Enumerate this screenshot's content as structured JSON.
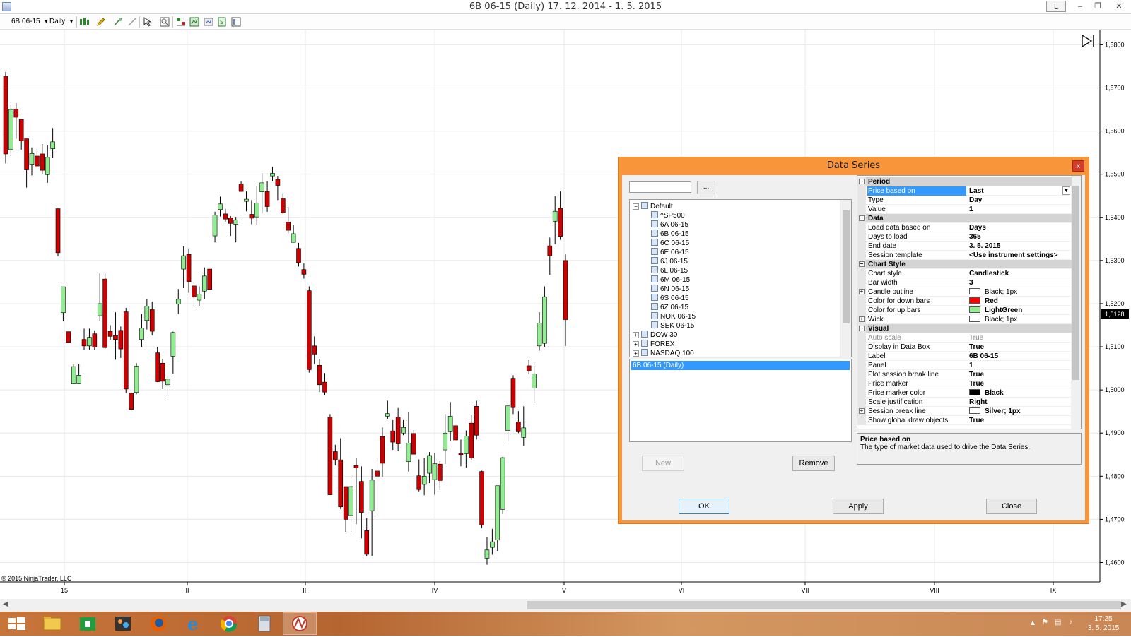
{
  "window": {
    "title": "6B 06-15 (Daily)  17. 12. 2014 - 1. 5. 2015",
    "link_button": "L",
    "minimize": "–",
    "restore": "❐",
    "close": "✕"
  },
  "toolbar": {
    "instrument": "6B 06-15",
    "period": "Daily",
    "dropdown_glyph": "▾"
  },
  "chart": {
    "copyright": "© 2015 NinjaTrader, LLC",
    "current_price": "1,5128",
    "price_labels": [
      "1,5800",
      "1,5700",
      "1,5600",
      "1,5500",
      "1,5400",
      "1,5300",
      "1,5200",
      "1,5100",
      "1,5000",
      "1,4900",
      "1,4800",
      "1,4700",
      "1,4600"
    ],
    "time_labels": [
      "15",
      "II",
      "III",
      "IV",
      "V",
      "VI",
      "VII",
      "VIII",
      "IX"
    ],
    "up_color": "#90EE90",
    "down_color": "#CC0000",
    "wick_color": "#000000"
  },
  "chart_data": {
    "type": "candlestick",
    "title": "6B 06-15 (Daily)",
    "ylim": [
      1.4555,
      1.5835
    ],
    "y_ticks": [
      1.58,
      1.57,
      1.56,
      1.55,
      1.54,
      1.53,
      1.52,
      1.51,
      1.5,
      1.49,
      1.48,
      1.47,
      1.46
    ],
    "x_ticks": [
      "15",
      "II",
      "III",
      "IV",
      "V",
      "VI",
      "VII",
      "VIII",
      "IX"
    ],
    "last_price": 1.5128,
    "candles": [
      {
        "o": 1.5727,
        "h": 1.5737,
        "l": 1.5525,
        "c": 1.5547
      },
      {
        "o": 1.5557,
        "h": 1.5661,
        "l": 1.5542,
        "c": 1.565
      },
      {
        "o": 1.5651,
        "h": 1.5665,
        "l": 1.5582,
        "c": 1.5632
      },
      {
        "o": 1.5627,
        "h": 1.56,
        "l": 1.5557,
        "c": 1.5577
      },
      {
        "o": 1.5582,
        "h": 1.5562,
        "l": 1.5469,
        "c": 1.551
      },
      {
        "o": 1.5523,
        "h": 1.5562,
        "l": 1.5497,
        "c": 1.5548
      },
      {
        "o": 1.5542,
        "h": 1.5562,
        "l": 1.5515,
        "c": 1.5519
      },
      {
        "o": 1.5547,
        "h": 1.557,
        "l": 1.55,
        "c": 1.5509
      },
      {
        "o": 1.5499,
        "h": 1.5567,
        "l": 1.548,
        "c": 1.5539
      },
      {
        "o": 1.5559,
        "h": 1.5607,
        "l": 1.5537,
        "c": 1.5575
      },
      {
        "o": 1.542,
        "h": 1.542,
        "l": 1.531,
        "c": 1.5318
      },
      {
        "o": 1.5179,
        "h": 1.5239,
        "l": 1.5159,
        "c": 1.5239
      },
      {
        "o": 1.5135,
        "h": 1.5135,
        "l": 1.511,
        "c": 1.511
      },
      {
        "o": 1.5014,
        "h": 1.506,
        "l": 1.5031,
        "c": 1.5054
      },
      {
        "o": 1.5014,
        "h": 1.506,
        "l": 1.5034,
        "c": 1.5034
      },
      {
        "o": 1.5117,
        "h": 1.5142,
        "l": 1.5092,
        "c": 1.5102
      },
      {
        "o": 1.5102,
        "h": 1.5142,
        "l": 1.5092,
        "c": 1.5122
      },
      {
        "o": 1.513,
        "h": 1.5138,
        "l": 1.5092,
        "c": 1.5099
      },
      {
        "o": 1.5172,
        "h": 1.527,
        "l": 1.5159,
        "c": 1.52
      },
      {
        "o": 1.5257,
        "h": 1.527,
        "l": 1.5095,
        "c": 1.5098
      },
      {
        "o": 1.5136,
        "h": 1.515,
        "l": 1.5116,
        "c": 1.5124
      },
      {
        "o": 1.5126,
        "h": 1.518,
        "l": 1.507,
        "c": 1.5117
      },
      {
        "o": 1.5138,
        "h": 1.5147,
        "l": 1.5074,
        "c": 1.5095
      },
      {
        "o": 1.5181,
        "h": 1.519,
        "l": 1.4993,
        "c": 1.5002
      },
      {
        "o": 1.4993,
        "h": 1.4974,
        "l": 1.4955,
        "c": 1.4955
      },
      {
        "o": 1.4994,
        "h": 1.5062,
        "l": 1.499,
        "c": 1.5055
      },
      {
        "o": 1.5117,
        "h": 1.5176,
        "l": 1.51,
        "c": 1.5143
      },
      {
        "o": 1.5161,
        "h": 1.521,
        "l": 1.514,
        "c": 1.5194
      },
      {
        "o": 1.5186,
        "h": 1.5205,
        "l": 1.5126,
        "c": 1.5136
      },
      {
        "o": 1.5086,
        "h": 1.51,
        "l": 1.5018,
        "c": 1.5019
      },
      {
        "o": 1.5062,
        "h": 1.5072,
        "l": 1.5002,
        "c": 1.502
      },
      {
        "o": 1.5012,
        "h": 1.5034,
        "l": 1.4986,
        "c": 1.5025
      },
      {
        "o": 1.5078,
        "h": 1.5135,
        "l": 1.5038,
        "c": 1.5133
      },
      {
        "o": 1.5199,
        "h": 1.5234,
        "l": 1.5176,
        "c": 1.521
      },
      {
        "o": 1.528,
        "h": 1.5333,
        "l": 1.5236,
        "c": 1.5311
      },
      {
        "o": 1.5314,
        "h": 1.5328,
        "l": 1.5225,
        "c": 1.5251
      },
      {
        "o": 1.5241,
        "h": 1.5249,
        "l": 1.5195,
        "c": 1.5215
      },
      {
        "o": 1.5208,
        "h": 1.524,
        "l": 1.5195,
        "c": 1.5222
      },
      {
        "o": 1.5229,
        "h": 1.5284,
        "l": 1.521,
        "c": 1.5264
      },
      {
        "o": 1.528,
        "h": 1.5268,
        "l": 1.5233,
        "c": 1.5233
      },
      {
        "o": 1.5357,
        "h": 1.5413,
        "l": 1.5342,
        "c": 1.5405
      },
      {
        "o": 1.5418,
        "h": 1.5448,
        "l": 1.5402,
        "c": 1.5431
      },
      {
        "o": 1.5408,
        "h": 1.542,
        "l": 1.539,
        "c": 1.5396
      },
      {
        "o": 1.5399,
        "h": 1.5403,
        "l": 1.5357,
        "c": 1.5386
      },
      {
        "o": 1.5384,
        "h": 1.5401,
        "l": 1.5342,
        "c": 1.5394
      },
      {
        "o": 1.5477,
        "h": 1.5483,
        "l": 1.546,
        "c": 1.546
      },
      {
        "o": 1.5437,
        "h": 1.546,
        "l": 1.5414,
        "c": 1.5442
      },
      {
        "o": 1.5407,
        "h": 1.544,
        "l": 1.5384,
        "c": 1.5398
      },
      {
        "o": 1.5401,
        "h": 1.5473,
        "l": 1.5382,
        "c": 1.5433
      },
      {
        "o": 1.5459,
        "h": 1.5502,
        "l": 1.5409,
        "c": 1.548
      },
      {
        "o": 1.546,
        "h": 1.5484,
        "l": 1.5413,
        "c": 1.5425
      },
      {
        "o": 1.5496,
        "h": 1.5517,
        "l": 1.5484,
        "c": 1.5502
      },
      {
        "o": 1.5488,
        "h": 1.5496,
        "l": 1.544,
        "c": 1.5474
      },
      {
        "o": 1.5443,
        "h": 1.5456,
        "l": 1.5408,
        "c": 1.5411
      },
      {
        "o": 1.5389,
        "h": 1.5424,
        "l": 1.5363,
        "c": 1.537
      },
      {
        "o": 1.5342,
        "h": 1.5382,
        "l": 1.5345,
        "c": 1.5362
      },
      {
        "o": 1.5328,
        "h": 1.5341,
        "l": 1.5286,
        "c": 1.5295
      },
      {
        "o": 1.5279,
        "h": 1.5293,
        "l": 1.5258,
        "c": 1.5268
      },
      {
        "o": 1.523,
        "h": 1.524,
        "l": 1.504,
        "c": 1.5047
      },
      {
        "o": 1.5102,
        "h": 1.5124,
        "l": 1.506,
        "c": 1.5083
      },
      {
        "o": 1.5057,
        "h": 1.5072,
        "l": 1.4995,
        "c": 1.5012
      },
      {
        "o": 1.5018,
        "h": 1.5039,
        "l": 1.4987,
        "c": 1.4995
      },
      {
        "o": 1.4937,
        "h": 1.4944,
        "l": 1.4758,
        "c": 1.4757
      },
      {
        "o": 1.4857,
        "h": 1.4873,
        "l": 1.4825,
        "c": 1.4838
      },
      {
        "o": 1.4838,
        "h": 1.4888,
        "l": 1.4724,
        "c": 1.4729
      },
      {
        "o": 1.4776,
        "h": 1.4775,
        "l": 1.4671,
        "c": 1.47
      },
      {
        "o": 1.4709,
        "h": 1.4798,
        "l": 1.4672,
        "c": 1.4776
      },
      {
        "o": 1.4825,
        "h": 1.4843,
        "l": 1.4689,
        "c": 1.4819
      },
      {
        "o": 1.4788,
        "h": 1.4823,
        "l": 1.4656,
        "c": 1.4716
      },
      {
        "o": 1.4674,
        "h": 1.4703,
        "l": 1.4614,
        "c": 1.4619
      },
      {
        "o": 1.472,
        "h": 1.4817,
        "l": 1.4615,
        "c": 1.4791
      },
      {
        "o": 1.4812,
        "h": 1.4841,
        "l": 1.4702,
        "c": 1.48
      },
      {
        "o": 1.4892,
        "h": 1.4913,
        "l": 1.4799,
        "c": 1.483
      },
      {
        "o": 1.4939,
        "h": 1.4975,
        "l": 1.4933,
        "c": 1.4945
      },
      {
        "o": 1.4905,
        "h": 1.493,
        "l": 1.4861,
        "c": 1.4879
      },
      {
        "o": 1.4937,
        "h": 1.4958,
        "l": 1.4858,
        "c": 1.4875
      },
      {
        "o": 1.49,
        "h": 1.493,
        "l": 1.4895,
        "c": 1.4913
      },
      {
        "o": 1.4834,
        "h": 1.4948,
        "l": 1.4811,
        "c": 1.4877
      },
      {
        "o": 1.4899,
        "h": 1.4907,
        "l": 1.4851,
        "c": 1.4851
      },
      {
        "o": 1.4801,
        "h": 1.4839,
        "l": 1.4765,
        "c": 1.4769
      },
      {
        "o": 1.4781,
        "h": 1.4843,
        "l": 1.4756,
        "c": 1.48
      },
      {
        "o": 1.4807,
        "h": 1.4856,
        "l": 1.4784,
        "c": 1.4848
      },
      {
        "o": 1.4792,
        "h": 1.4854,
        "l": 1.4757,
        "c": 1.4829
      },
      {
        "o": 1.4828,
        "h": 1.4835,
        "l": 1.4768,
        "c": 1.479
      },
      {
        "o": 1.4861,
        "h": 1.4944,
        "l": 1.4828,
        "c": 1.49
      },
      {
        "o": 1.4903,
        "h": 1.4972,
        "l": 1.4882,
        "c": 1.4939
      },
      {
        "o": 1.4917,
        "h": 1.4909,
        "l": 1.4884,
        "c": 1.4884
      },
      {
        "o": 1.4853,
        "h": 1.4885,
        "l": 1.4823,
        "c": 1.485
      },
      {
        "o": 1.4852,
        "h": 1.4906,
        "l": 1.482,
        "c": 1.4893
      },
      {
        "o": 1.4923,
        "h": 1.4943,
        "l": 1.4837,
        "c": 1.4842
      },
      {
        "o": 1.4962,
        "h": 1.4975,
        "l": 1.4885,
        "c": 1.4895
      },
      {
        "o": 1.4811,
        "h": 1.4813,
        "l": 1.468,
        "c": 1.4687
      },
      {
        "o": 1.461,
        "h": 1.4659,
        "l": 1.4595,
        "c": 1.4629
      },
      {
        "o": 1.4635,
        "h": 1.4678,
        "l": 1.4618,
        "c": 1.4648
      },
      {
        "o": 1.4652,
        "h": 1.476,
        "l": 1.4627,
        "c": 1.4778
      },
      {
        "o": 1.4723,
        "h": 1.4845,
        "l": 1.4712,
        "c": 1.4843
      },
      {
        "o": 1.4906,
        "h": 1.4962,
        "l": 1.488,
        "c": 1.4963
      },
      {
        "o": 1.5027,
        "h": 1.5034,
        "l": 1.4944,
        "c": 1.4959
      },
      {
        "o": 1.4926,
        "h": 1.4951,
        "l": 1.49,
        "c": 1.4903
      },
      {
        "o": 1.489,
        "h": 1.4962,
        "l": 1.487,
        "c": 1.4912
      },
      {
        "o": 1.5056,
        "h": 1.5069,
        "l": 1.5036,
        "c": 1.5044
      },
      {
        "o": 1.5004,
        "h": 1.5064,
        "l": 1.497,
        "c": 1.5037
      },
      {
        "o": 1.5102,
        "h": 1.518,
        "l": 1.5091,
        "c": 1.5155
      },
      {
        "o": 1.5108,
        "h": 1.524,
        "l": 1.51,
        "c": 1.5216
      },
      {
        "o": 1.5334,
        "h": 1.5353,
        "l": 1.5267,
        "c": 1.5311
      },
      {
        "o": 1.5391,
        "h": 1.5449,
        "l": 1.5338,
        "c": 1.5414
      },
      {
        "o": 1.5421,
        "h": 1.546,
        "l": 1.5348,
        "c": 1.5356
      },
      {
        "o": 1.53,
        "h": 1.5314,
        "l": 1.5102,
        "c": 1.5163
      }
    ]
  },
  "dialog": {
    "title": "Data Series",
    "close": "x",
    "browse_label": "...",
    "tree": [
      {
        "label": "Default",
        "level": 0,
        "expanded": true
      },
      {
        "label": "^SP500",
        "level": 1
      },
      {
        "label": "6A 06-15",
        "level": 1
      },
      {
        "label": "6B 06-15",
        "level": 1
      },
      {
        "label": "6C 06-15",
        "level": 1
      },
      {
        "label": "6E 06-15",
        "level": 1
      },
      {
        "label": "6J 06-15",
        "level": 1
      },
      {
        "label": "6L 06-15",
        "level": 1
      },
      {
        "label": "6M 06-15",
        "level": 1
      },
      {
        "label": "6N 06-15",
        "level": 1
      },
      {
        "label": "6S 06-15",
        "level": 1
      },
      {
        "label": "6Z 06-15",
        "level": 1
      },
      {
        "label": "NOK 06-15",
        "level": 1
      },
      {
        "label": "SEK 06-15",
        "level": 1
      },
      {
        "label": "DOW 30",
        "level": 0
      },
      {
        "label": "FOREX",
        "level": 0
      },
      {
        "label": "NASDAQ 100",
        "level": 0
      }
    ],
    "selected_series": "6B 06-15 (Daily)",
    "new_label": "New",
    "remove_label": "Remove",
    "ok_label": "OK",
    "apply_label": "Apply",
    "close_label": "Close",
    "properties": [
      {
        "kind": "cat",
        "name": "Period"
      },
      {
        "kind": "sel",
        "name": "Price based on",
        "value": "Last"
      },
      {
        "name": "Type",
        "value": "Day"
      },
      {
        "name": "Value",
        "value": "1"
      },
      {
        "kind": "cat",
        "name": "Data"
      },
      {
        "name": "Load data based on",
        "value": "Days"
      },
      {
        "name": "Days to load",
        "value": "365"
      },
      {
        "name": "End date",
        "value": "3. 5. 2015"
      },
      {
        "name": "Session template",
        "value": "<Use instrument settings>"
      },
      {
        "kind": "cat",
        "name": "Chart Style"
      },
      {
        "name": "Chart style",
        "value": "Candlestick"
      },
      {
        "name": "Bar width",
        "value": "3"
      },
      {
        "name": "Candle outline",
        "value": "Black; 1px",
        "swatch": "#ffffff",
        "expand": true,
        "normal": true
      },
      {
        "name": "Color for down bars",
        "value": "Red",
        "swatch": "#ff0000"
      },
      {
        "name": "Color for up bars",
        "value": "LightGreen",
        "swatch": "#90ee90"
      },
      {
        "name": "Wick",
        "value": "Black; 1px",
        "swatch": "#ffffff",
        "expand": true,
        "normal": true
      },
      {
        "kind": "cat",
        "name": "Visual"
      },
      {
        "kind": "dim",
        "name": "Auto scale",
        "value": "True"
      },
      {
        "name": "Display in Data Box",
        "value": "True"
      },
      {
        "name": "Label",
        "value": "6B 06-15"
      },
      {
        "name": "Panel",
        "value": "1"
      },
      {
        "name": "Plot session break line",
        "value": "True"
      },
      {
        "name": "Price marker",
        "value": "True"
      },
      {
        "name": "Price marker color",
        "value": "Black",
        "swatch": "#000000"
      },
      {
        "name": "Scale justification",
        "value": "Right"
      },
      {
        "name": "Session break line",
        "value": "Silver; 1px",
        "swatch": "#ffffff",
        "expand": true
      },
      {
        "name": "Show global draw objects",
        "value": "True"
      }
    ],
    "desc_title": "Price based on",
    "desc_text": "The type of market data used to drive the Data Series."
  },
  "taskbar": {
    "time": "17:25",
    "date": "3. 5. 2015"
  }
}
